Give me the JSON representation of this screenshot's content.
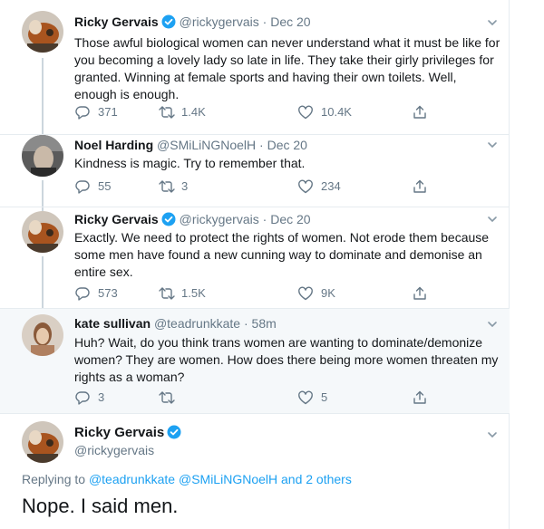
{
  "tweets": [
    {
      "name": "Ricky Gervais",
      "verified": true,
      "handle": "@rickygervais",
      "time": "Dec 20",
      "text": "Those awful biological women can never understand what it must be like for you becoming a lovely lady so late in life. They take their girly privileges for granted. Winning at female sports and having their own toilets. Well, enough is enough.",
      "replies": "371",
      "retweets": "1.4K",
      "likes": "10.4K"
    },
    {
      "name": "Noel Harding",
      "verified": false,
      "handle": "@SMiLiNGNoelH",
      "time": "Dec 20",
      "text": "Kindness is magic. Try to remember that.",
      "replies": "55",
      "retweets": "3",
      "likes": "234"
    },
    {
      "name": "Ricky Gervais",
      "verified": true,
      "handle": "@rickygervais",
      "time": "Dec 20",
      "text": "Exactly. We need to protect the rights of women. Not erode them because some men have found a new cunning way to dominate and demonise an entire sex.",
      "replies": "573",
      "retweets": "1.5K",
      "likes": "9K"
    },
    {
      "name": "kate sullivan",
      "verified": false,
      "handle": "@teadrunkkate",
      "time": "58m",
      "text": "Huh? Wait, do you think trans women are wanting to dominate/demonize women? They are women. How does there being more women threaten my rights as a woman?",
      "replies": "3",
      "retweets": "",
      "likes": "5"
    }
  ],
  "main_tweet": {
    "name": "Ricky Gervais",
    "verified": true,
    "handle": "@rickygervais",
    "replying_prefix": "Replying to",
    "replying_to": "@teadrunkkate @SMiLiNGNoelH and 2 others",
    "text": "Nope. I said men."
  },
  "colors": {
    "accent": "#1da1f2",
    "secondary_text": "#657786",
    "highlight_bg": "#f5f8fa",
    "border": "#e6ecf0"
  }
}
